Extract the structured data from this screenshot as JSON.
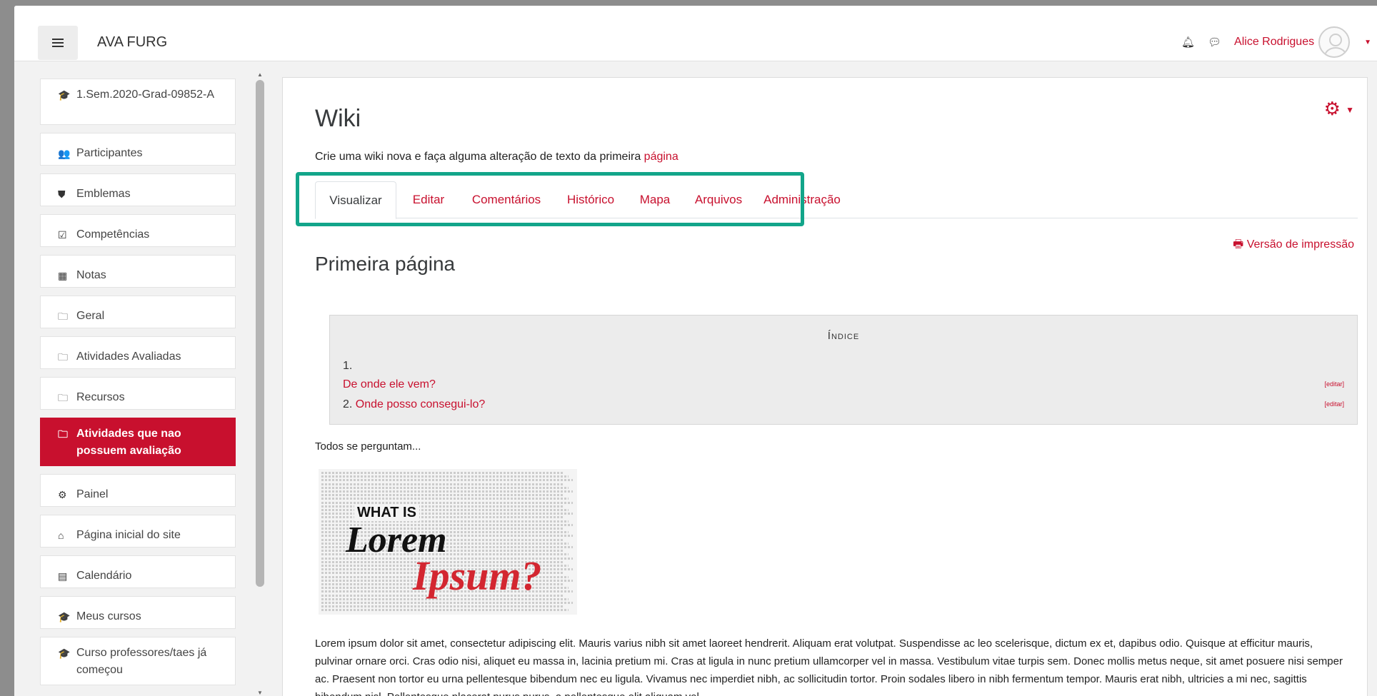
{
  "navbar": {
    "brand": "AVA FURG",
    "user_name": "Alice Rodrigues"
  },
  "sidebar": {
    "items": [
      {
        "icon": "graduation-cap-icon",
        "glyph": "🎓",
        "label": "1.Sem.2020-Grad-09852-A"
      },
      {
        "icon": "users-icon",
        "glyph": "👥",
        "label": "Participantes"
      },
      {
        "icon": "shield-icon",
        "glyph": "⛊",
        "label": "Emblemas"
      },
      {
        "icon": "checkbox-icon",
        "glyph": "☑",
        "label": "Competências"
      },
      {
        "icon": "table-icon",
        "glyph": "▦",
        "label": "Notas"
      },
      {
        "icon": "folder-icon",
        "glyph": "🗀",
        "label": "Geral"
      },
      {
        "icon": "folder-icon",
        "glyph": "🗀",
        "label": "Atividades Avaliadas"
      },
      {
        "icon": "folder-icon",
        "glyph": "🗀",
        "label": "Recursos"
      },
      {
        "icon": "folder-icon",
        "glyph": "🗀",
        "label": "Atividades que nao possuem avaliação"
      },
      {
        "icon": "dashboard-icon",
        "glyph": "⚙",
        "label": "Painel"
      },
      {
        "icon": "home-icon",
        "glyph": "⌂",
        "label": "Página inicial do site"
      },
      {
        "icon": "calendar-icon",
        "glyph": "▤",
        "label": "Calendário"
      },
      {
        "icon": "graduation-cap-icon",
        "glyph": "🎓",
        "label": "Meus cursos"
      },
      {
        "icon": "graduation-cap-icon",
        "glyph": "🎓",
        "label": "Curso professores/taes já começou"
      }
    ],
    "active_index": 8
  },
  "main": {
    "title": "Wiki",
    "intro_text": "Crie uma wiki nova e faça alguma alteração de texto da primeira ",
    "intro_link": "página",
    "tabs": [
      "Visualizar",
      "Editar",
      "Comentários",
      "Histórico",
      "Mapa",
      "Arquivos",
      "Administração"
    ],
    "active_tab": 0,
    "print_link": "Versão de impressão",
    "page_title": "Primeira página",
    "toc": {
      "heading": "Índice",
      "item1_number": "1.",
      "item1_label": "De onde ele vem?",
      "item2_number": "2.",
      "item2_label": "Onde posso consegui-lo?",
      "edit_label": "[editar]"
    },
    "lead_text": "Todos se perguntam...",
    "image": {
      "line1": "WHAT IS",
      "line2": "Lorem",
      "line3": "Ipsum?"
    },
    "body_text": "Lorem ipsum dolor sit amet, consectetur adipiscing elit. Mauris varius nibh sit amet laoreet hendrerit. Aliquam erat volutpat. Suspendisse ac leo scelerisque, dictum ex et, dapibus odio. Quisque at efficitur mauris, pulvinar ornare orci. Cras odio nisi, aliquet eu massa in, lacinia pretium mi. Cras at ligula in nunc pretium ullamcorper vel in massa. Vestibulum vitae turpis sem. Donec mollis metus neque, sit amet posuere nisi semper ac. Praesent non tortor eu urna pellentesque bibendum nec eu ligula. Vivamus nec imperdiet nibh, ac sollicitudin tortor. Proin sodales libero in nibh fermentum tempor. Mauris erat nibh, ultricies a mi nec, sagittis bibendum nisl. Pellentesque placerat purus purus, a pellentesque elit aliquam vel."
  },
  "colors": {
    "accent": "#c8102e",
    "highlight": "#12a58a"
  }
}
